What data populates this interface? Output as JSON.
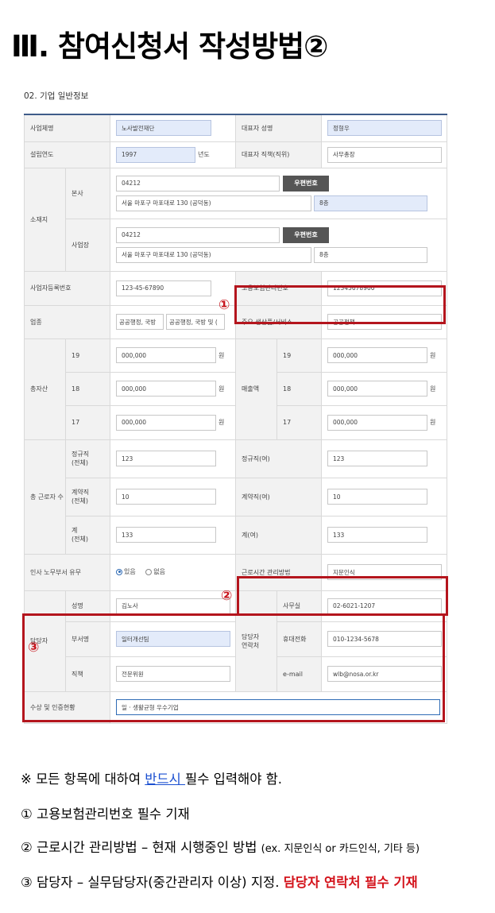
{
  "title": "Ⅲ. 참여신청서 작성방법②",
  "section_title": "02. 기업 일반정보",
  "labels": {
    "biz_name": "사업체명",
    "ceo_name": "대표자 성명",
    "est_year": "설립연도",
    "ceo_position": "대표자 직책(직위)",
    "location": "소재지",
    "hq": "본사",
    "site": "사업장",
    "zip_button": "우편번호",
    "reg_no": "사업자등록번호",
    "insurance_no": "고용보험관리번호",
    "industry": "업종",
    "main_product": "주요 생산품/서비스",
    "assets": "총자산",
    "sales": "매출액",
    "total_workers": "총 근로자 수",
    "regular": "정규직\n(전체)",
    "contract": "계약직\n(전체)",
    "sum": "계\n(전체)",
    "regular_f": "정규직(여)",
    "contract_f": "계약직(여)",
    "sum_f": "계(여)",
    "hr_dept": "인사 노무부서 유무",
    "work_time": "근로시간 관리방법",
    "manager": "담당자",
    "name": "성명",
    "dept": "부서명",
    "title": "직책",
    "contact": "담당자\n연락처",
    "office": "사무실",
    "mobile": "휴대전화",
    "email": "e-mail",
    "awards": "수상 및 인증현황",
    "won": "원",
    "year_unit": "년도"
  },
  "values": {
    "biz_name": "노사발전재단",
    "ceo_name": "정형우",
    "est_year": "1997",
    "ceo_position": "사무총장",
    "hq_zip": "04212",
    "hq_addr": "서울 마포구 마포대로 130 (공덕동)",
    "hq_detail": "8층",
    "site_zip": "04212",
    "site_addr": "서울 마포구 마포대로 130 (공덕동)",
    "site_detail": "8층",
    "reg_no": "123-45-67890",
    "insurance_no": "12345678900",
    "industry1": "공공행정, 국방",
    "industry2": "공공행정, 국방 및 (",
    "main_product": "공공정책",
    "years": [
      "19",
      "18",
      "17"
    ],
    "assets": [
      "000,000",
      "000,000",
      "000,000"
    ],
    "sales": [
      "000,000",
      "000,000",
      "000,000"
    ],
    "regular": "123",
    "contract": "10",
    "sum": "133",
    "regular_f": "123",
    "contract_f": "10",
    "sum_f": "133",
    "hr_yes": "있음",
    "hr_no": "없음",
    "work_time": "지문인식",
    "name": "김노사",
    "dept": "일터개선팀",
    "title": "전문위원",
    "office": "02-6021-1207",
    "mobile": "010-1234-5678",
    "email": "wlb@nosa.or.kr",
    "awards": "일 · 생활균형 우수기업"
  },
  "markers": [
    "①",
    "②",
    "③"
  ],
  "notes": {
    "line1_pre": "※ 모든 항목에 대하여 ",
    "line1_em": "반드시 ",
    "line1_post": "필수 입력해야 함.",
    "line2": "① 고용보험관리번호 필수 기재",
    "line3_pre": "② 근로시간 관리방법 – 현재 시행중인 방법 ",
    "line3_small": "(ex. 지문인식 or 카드인식, 기타 등)",
    "line4_pre": "③ 담당자 – 실무담당자(중간관리자 이상) 지정. ",
    "line4_red": "담당자 연락처 필수 기재"
  },
  "colors": {
    "header_rule": "#3f5c8a",
    "highlight": "#b4151d",
    "accent_blue": "#1a4fd0"
  }
}
